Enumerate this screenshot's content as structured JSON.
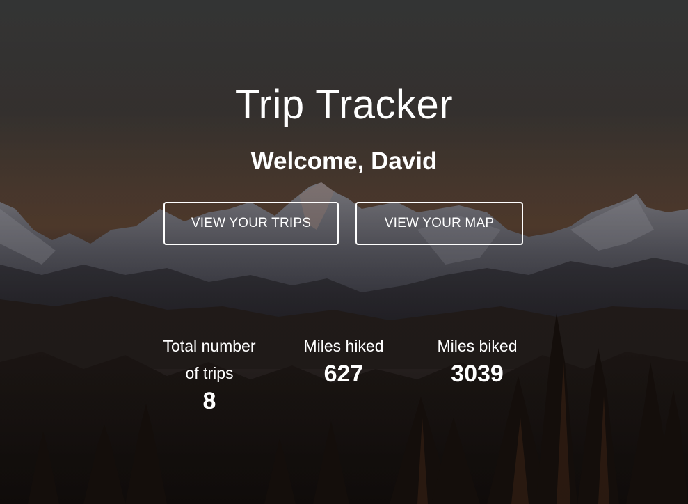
{
  "app": {
    "title": "Trip Tracker",
    "welcome": "Welcome, David"
  },
  "actions": {
    "view_trips": "VIEW YOUR TRIPS",
    "view_map": "VIEW YOUR MAP"
  },
  "stats": [
    {
      "label": "Total number of trips",
      "value": "8"
    },
    {
      "label": "Miles hiked",
      "value": "627"
    },
    {
      "label": "Miles biked",
      "value": "3039"
    }
  ],
  "colors": {
    "text": "#ffffff",
    "sky_top": "#3b3c3d",
    "sky_glow": "#6b4a35",
    "forest": "#1a1512"
  },
  "background_image": "mountain-forest-landscape"
}
